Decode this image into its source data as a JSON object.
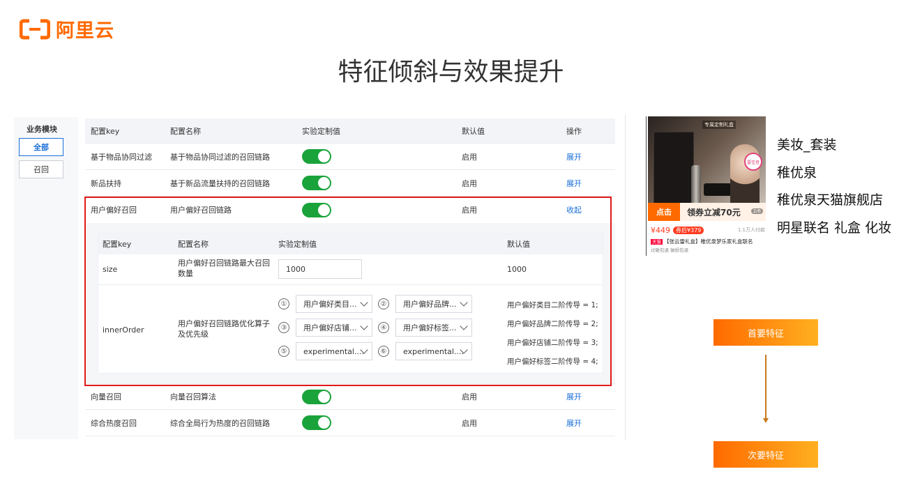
{
  "logo": {
    "text": "阿里云",
    "mark": "aliyun-bracket-logo",
    "color": "#ff6a00"
  },
  "page_title": "特征倾斜与效果提升",
  "sidebar": {
    "title": "业务模块",
    "items": [
      {
        "label": "全部",
        "active": true
      },
      {
        "label": "召回",
        "active": false
      }
    ]
  },
  "table": {
    "headers": [
      "配置key",
      "配置名称",
      "实验定制值",
      "默认值",
      "操作"
    ],
    "rows": [
      {
        "key": "基于物品协同过滤",
        "name": "基于物品协同过滤的召回链路",
        "enabled": true,
        "default": "启用",
        "action": "展开"
      },
      {
        "key": "新品扶持",
        "name": "基于新品流量扶持的召回链路",
        "enabled": true,
        "default": "启用",
        "action": "展开"
      },
      {
        "key": "用户偏好召回",
        "name": "用户偏好召回链路",
        "enabled": true,
        "default": "启用",
        "action": "收起"
      },
      {
        "key": "向量召回",
        "name": "向量召回算法",
        "enabled": true,
        "default": "启用",
        "action": "展开"
      },
      {
        "key": "综合热度召回",
        "name": "综合全局行为热度的召回链路",
        "enabled": true,
        "default": "启用",
        "action": "展开"
      }
    ]
  },
  "inner": {
    "headers": [
      "配置key",
      "配置名称",
      "实验定制值",
      "默认值"
    ],
    "size": {
      "key": "size",
      "name_line1": "用户偏好召回链路最大召回",
      "name_line2": "数量",
      "value": "1000",
      "default": "1000"
    },
    "order": {
      "key": "innerOrder",
      "name_line1": "用户偏好召回链路优化算子",
      "name_line2": "及优先级",
      "selects": [
        {
          "num": "①",
          "value": "用户偏好类目..."
        },
        {
          "num": "②",
          "value": "用户偏好品牌..."
        },
        {
          "num": "③",
          "value": "用户偏好店铺..."
        },
        {
          "num": "④",
          "value": "用户偏好标签..."
        },
        {
          "num": "⑤",
          "value": "experimental...."
        },
        {
          "num": "⑥",
          "value": "experimental...."
        }
      ],
      "defaults": [
        "用户偏好类目二阶传导 = 1;",
        "用户偏好品牌二阶传导 = 2;",
        "用户偏好店铺二阶传导 = 3;",
        "用户偏好标签二阶传导 = 4;"
      ]
    }
  },
  "product": {
    "img_tag": "专属定制礼盒",
    "badge": "雷佳音",
    "click_label": "点击",
    "coupon": "领券立减70元",
    "page_indicator": "2/6",
    "price": "¥449",
    "price_tag": "券后¥379",
    "sold": "1.1万人付款",
    "tmall": "天猫",
    "title": "【张云雷礼盒】稚优泉梦乐家礼盒联名",
    "sub": "过敏包退  破损包退"
  },
  "features": [
    "美妆_套装",
    "稚优泉",
    "稚优泉天猫旗舰店",
    "明星联名 礼盒 化妆"
  ],
  "flow": {
    "primary": "首要特征",
    "secondary": "次要特征"
  },
  "colors": {
    "accent": "#ff6a00",
    "link": "#1a6fd8",
    "toggle_on": "#19a33a",
    "highlight": "#e0191a"
  }
}
